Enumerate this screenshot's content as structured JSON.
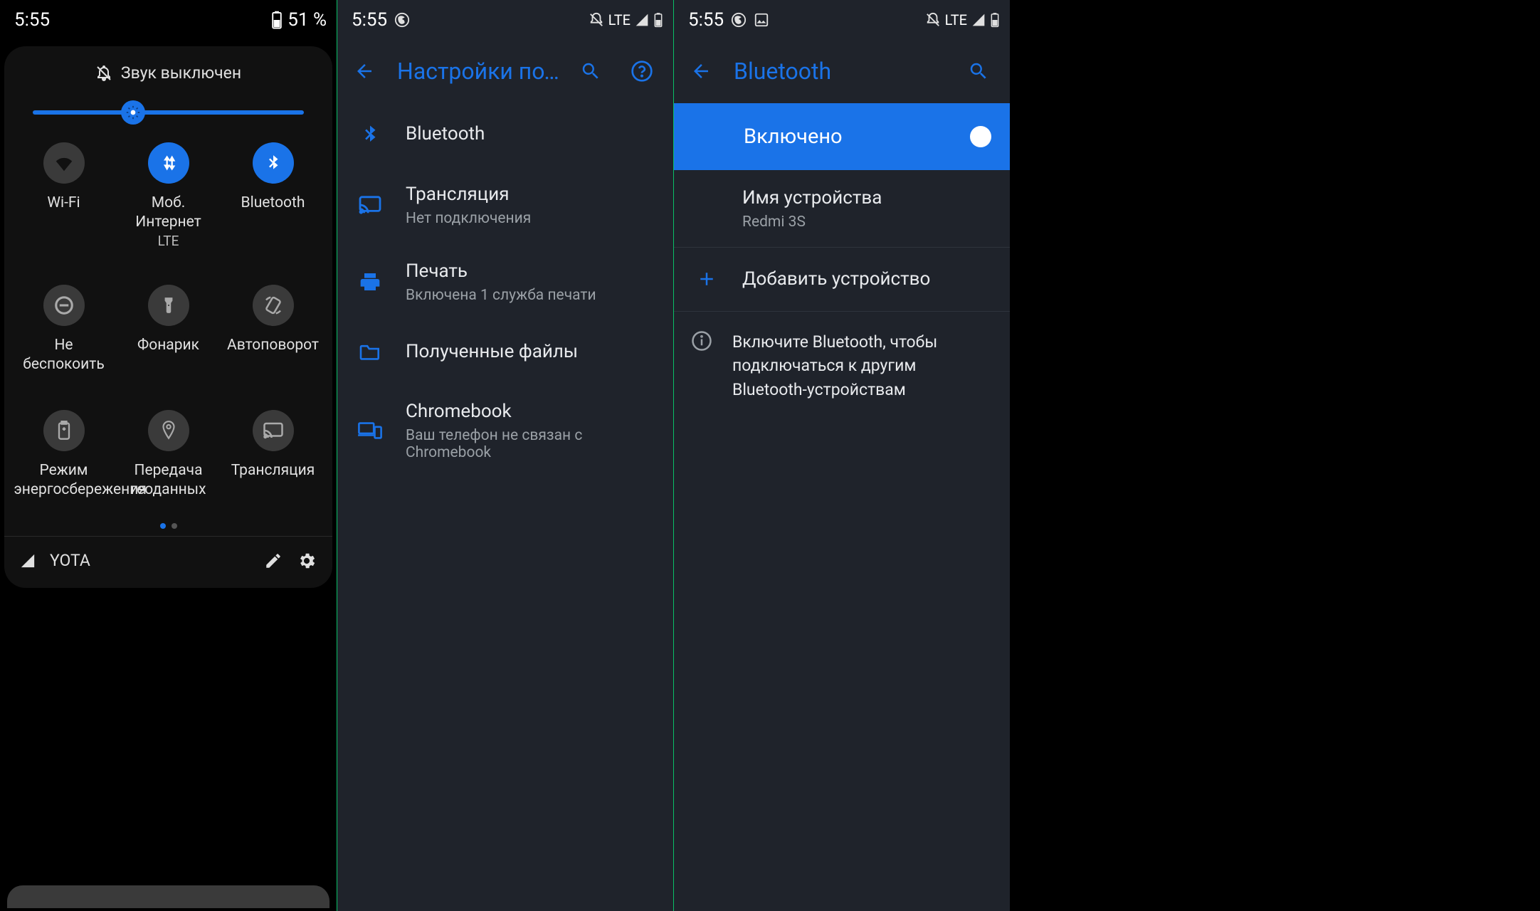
{
  "accent": "#1a73e8",
  "screens": {
    "s1": {
      "statusbar": {
        "time": "5:55",
        "battery": "51 %"
      },
      "mute_label": "Звук выключен",
      "brightness_pct": 37,
      "tiles": [
        {
          "id": "wifi",
          "label": "Wi-Fi",
          "sub": "",
          "on": false
        },
        {
          "id": "mobile",
          "label": "Моб. Интернет",
          "sub": "LTE",
          "on": true
        },
        {
          "id": "bluetooth",
          "label": "Bluetooth",
          "sub": "",
          "on": true
        },
        {
          "id": "dnd",
          "label": "Не беспокоить",
          "sub": "",
          "on": false
        },
        {
          "id": "torch",
          "label": "Фонарик",
          "sub": "",
          "on": false
        },
        {
          "id": "rotate",
          "label": "Автоповорот",
          "sub": "",
          "on": false
        },
        {
          "id": "battsave",
          "label": "Режим энергосбережения",
          "sub": "",
          "on": false
        },
        {
          "id": "location",
          "label": "Передача геоданных",
          "sub": "",
          "on": false
        },
        {
          "id": "cast",
          "label": "Трансляция",
          "sub": "",
          "on": false
        }
      ],
      "pages": {
        "count": 2,
        "active": 0
      },
      "carrier": "YOTA"
    },
    "s2": {
      "statusbar": {
        "time": "5:55",
        "net": "LTE"
      },
      "title": "Настройки подк…",
      "rows": [
        {
          "id": "bt",
          "title": "Bluetooth",
          "sub": ""
        },
        {
          "id": "cast",
          "title": "Трансляция",
          "sub": "Нет подключения"
        },
        {
          "id": "print",
          "title": "Печать",
          "sub": "Включена 1 служба печати"
        },
        {
          "id": "files",
          "title": "Полученные файлы",
          "sub": ""
        },
        {
          "id": "cbook",
          "title": "Chromebook",
          "sub": "Ваш телефон не связан с Chromebook"
        }
      ]
    },
    "s3": {
      "statusbar": {
        "time": "5:55",
        "net": "LTE"
      },
      "title": "Bluetooth",
      "enabled_label": "Включено",
      "device_name": {
        "title": "Имя устройства",
        "value": "Redmi 3S"
      },
      "add_device": "Добавить устройство",
      "info": "Включите Bluetooth, чтобы подключаться к другим Bluetooth-устройствам"
    }
  }
}
